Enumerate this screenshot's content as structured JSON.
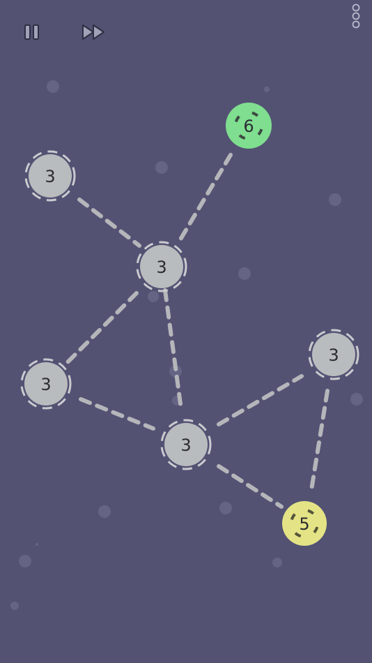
{
  "toolbar": {
    "pause_icon": "pause-icon",
    "fast_forward_icon": "fast-forward-icon",
    "menu_icon": "vertical-dots-menu-icon"
  },
  "colors": {
    "background": "#535273",
    "node_gray": "#b9bcbe",
    "node_green": "#7fde8f",
    "node_yellow": "#e4e486",
    "dashed_line": "#b4b6ba"
  },
  "nodes": [
    {
      "id": "n1",
      "label": "6",
      "state": "green"
    },
    {
      "id": "n2",
      "label": "3",
      "state": "gray"
    },
    {
      "id": "n3",
      "label": "3",
      "state": "gray"
    },
    {
      "id": "n4",
      "label": "3",
      "state": "gray"
    },
    {
      "id": "n5",
      "label": "3",
      "state": "gray"
    },
    {
      "id": "n6",
      "label": "3",
      "state": "gray"
    },
    {
      "id": "n7",
      "label": "5",
      "state": "yellow"
    }
  ],
  "edges": [
    [
      "n1",
      "n3"
    ],
    [
      "n2",
      "n3"
    ],
    [
      "n3",
      "n4"
    ],
    [
      "n3",
      "n6"
    ],
    [
      "n4",
      "n6"
    ],
    [
      "n5",
      "n6"
    ],
    [
      "n6",
      "n7"
    ],
    [
      "n5",
      "n7"
    ]
  ]
}
